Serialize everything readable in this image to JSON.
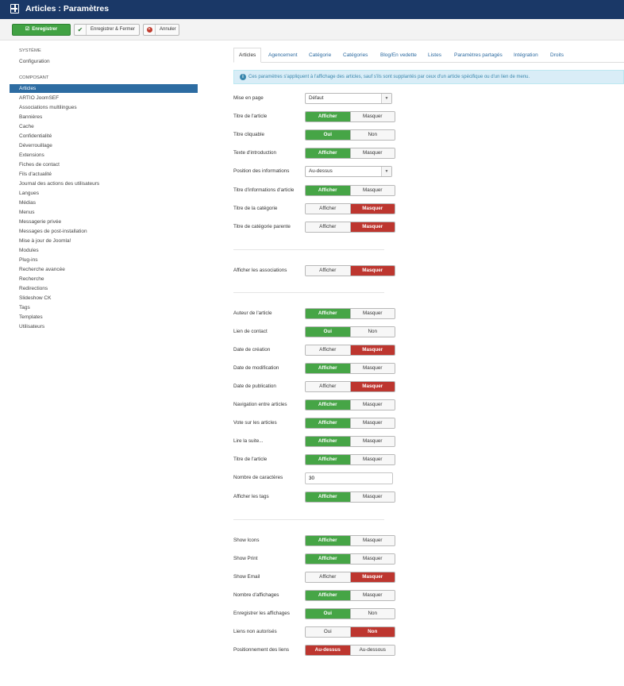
{
  "header": {
    "title": "Articles : Paramètres"
  },
  "toolbar": {
    "save_label": "Enregistrer",
    "save_close_label": "Enregistrer & Fermer",
    "cancel_label": "Annuler"
  },
  "sidebar": {
    "system_heading": "SYSTÈME",
    "system_items": [
      "Configuration"
    ],
    "component_heading": "COMPOSANT",
    "component_items": [
      "Articles",
      "ARTIO JoomSEF",
      "Associations multilingues",
      "Bannières",
      "Cache",
      "Confidentialité",
      "Déverrouillage",
      "Extensions",
      "Fiches de contact",
      "Fils d'actualité",
      "Journal des actions des utilisateurs",
      "Langues",
      "Médias",
      "Menus",
      "Messagerie privée",
      "Messages de post-installation",
      "Mise à jour de Joomla!",
      "Modules",
      "Plug-ins",
      "Recherche avancée",
      "Recherche",
      "Redirections",
      "Slideshow CK",
      "Tags",
      "Templates",
      "Utilisateurs"
    ],
    "active_item": "Articles"
  },
  "tabs": [
    "Articles",
    "Agencement",
    "Catégorie",
    "Catégories",
    "Blog/En vedette",
    "Listes",
    "Paramètres partagés",
    "Intégration",
    "Droits"
  ],
  "info_text": "Ces paramètres s'appliquent à l'affichage des articles, sauf s'ils sont supplantés par ceux d'un article spécifique ou d'un lien de menu.",
  "form": {
    "layout": {
      "label": "Mise en page",
      "value": "Défaut"
    },
    "title": {
      "label": "Titre de l'article",
      "on": "Afficher",
      "off": "Masquer",
      "state": "on"
    },
    "linked_title": {
      "label": "Titre cliquable",
      "on": "Oui",
      "off": "Non",
      "state": "on"
    },
    "intro": {
      "label": "Texte d'introduction",
      "on": "Afficher",
      "off": "Masquer",
      "state": "on"
    },
    "info_position": {
      "label": "Position des informations",
      "value": "Au-dessus"
    },
    "info_title": {
      "label": "Titre d'informations d'article",
      "on": "Afficher",
      "off": "Masquer",
      "state": "on"
    },
    "category_title": {
      "label": "Titre de la catégorie",
      "on": "Afficher",
      "off": "Masquer",
      "state": "off"
    },
    "parent_title": {
      "label": "Titre de catégorie parente",
      "on": "Afficher",
      "off": "Masquer",
      "state": "off"
    },
    "associations": {
      "label": "Afficher les associations",
      "on": "Afficher",
      "off": "Masquer",
      "state": "off"
    },
    "author": {
      "label": "Auteur de l'article",
      "on": "Afficher",
      "off": "Masquer",
      "state": "on"
    },
    "contact_link": {
      "label": "Lien de contact",
      "on": "Oui",
      "off": "Non",
      "state": "on"
    },
    "create_date": {
      "label": "Date de création",
      "on": "Afficher",
      "off": "Masquer",
      "state": "off"
    },
    "modify_date": {
      "label": "Date de modification",
      "on": "Afficher",
      "off": "Masquer",
      "state": "on"
    },
    "publish_date": {
      "label": "Date de publication",
      "on": "Afficher",
      "off": "Masquer",
      "state": "off"
    },
    "navigation": {
      "label": "Navigation entre articles",
      "on": "Afficher",
      "off": "Masquer",
      "state": "on"
    },
    "vote": {
      "label": "Vote sur les articles",
      "on": "Afficher",
      "off": "Masquer",
      "state": "on"
    },
    "readmore": {
      "label": "Lire la suite...",
      "on": "Afficher",
      "off": "Masquer",
      "state": "on"
    },
    "readmore_title": {
      "label": "Titre de l'article",
      "on": "Afficher",
      "off": "Masquer",
      "state": "on"
    },
    "char_count": {
      "label": "Nombre de caractères",
      "value": "30"
    },
    "tags": {
      "label": "Afficher les tags",
      "on": "Afficher",
      "off": "Masquer",
      "state": "on"
    },
    "icons": {
      "label": "Show Icons",
      "on": "Afficher",
      "off": "Masquer",
      "state": "on"
    },
    "print": {
      "label": "Show Print",
      "on": "Afficher",
      "off": "Masquer",
      "state": "on"
    },
    "email": {
      "label": "Show Email",
      "on": "Afficher",
      "off": "Masquer",
      "state": "off"
    },
    "hits": {
      "label": "Nombre d'affichages",
      "on": "Afficher",
      "off": "Masquer",
      "state": "on"
    },
    "record_hits": {
      "label": "Enregistrer les affichages",
      "on": "Oui",
      "off": "Non",
      "state": "on"
    },
    "unauth_links": {
      "label": "Liens non autorisés",
      "on": "Oui",
      "off": "Non",
      "state": "off"
    },
    "urls_position": {
      "label": "Positionnement des liens",
      "on": "Au-dessus",
      "off": "Au-dessous",
      "state": "on-red"
    }
  },
  "colors": {
    "header_bg": "#1a3867",
    "green": "#46a546",
    "red": "#bd362f",
    "active_blue": "#2d6ca2"
  }
}
